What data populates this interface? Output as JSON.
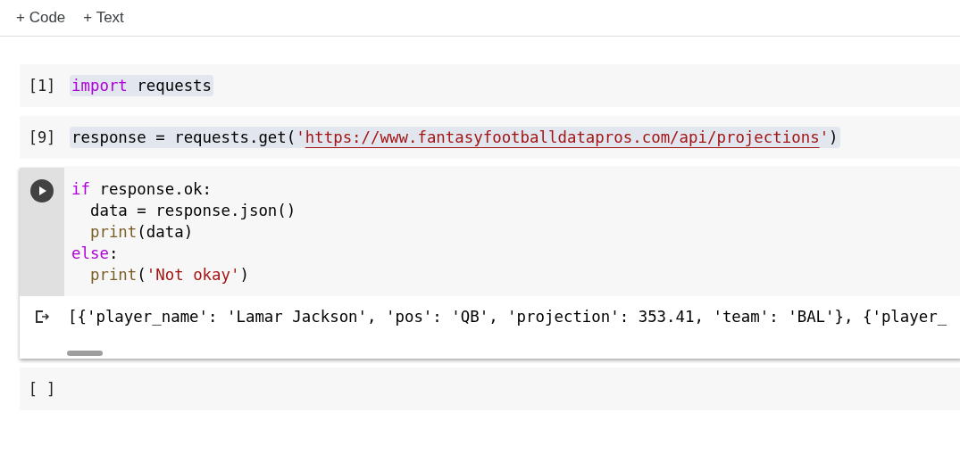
{
  "toolbar": [
    {
      "icon": "+",
      "label": "Code"
    },
    {
      "icon": "+",
      "label": "Text"
    }
  ],
  "cells": [
    {
      "kind": "code",
      "prompt": "[1]",
      "focused": false,
      "highlighted": true,
      "lines": [
        [
          {
            "kind": "keyword",
            "text": "import"
          },
          {
            "kind": "plain",
            "text": " requests"
          }
        ]
      ]
    },
    {
      "kind": "code",
      "prompt": "[9]",
      "focused": false,
      "highlighted": true,
      "lines": [
        [
          {
            "kind": "plain",
            "text": "response = requests.get("
          },
          {
            "kind": "string",
            "text": "'"
          },
          {
            "kind": "link",
            "text": "https://www.fantasyfootballdatapros.com/api/projections"
          },
          {
            "kind": "string",
            "text": "'"
          },
          {
            "kind": "plain",
            "text": ")"
          }
        ]
      ]
    },
    {
      "kind": "code",
      "focused": true,
      "lines": [
        [
          {
            "kind": "keyword",
            "text": "if"
          },
          {
            "kind": "plain",
            "text": " response.ok:"
          }
        ],
        [
          {
            "kind": "plain",
            "text": "  data = response.json()"
          }
        ],
        [
          {
            "kind": "builtin",
            "text": "  print"
          },
          {
            "kind": "plain",
            "text": "(data)"
          }
        ],
        [
          {
            "kind": "keyword",
            "text": "else"
          },
          {
            "kind": "plain",
            "text": ":"
          }
        ],
        [
          {
            "kind": "builtin",
            "text": "  print"
          },
          {
            "kind": "plain",
            "text": "("
          },
          {
            "kind": "string",
            "text": "'Not okay'"
          },
          {
            "kind": "plain",
            "text": ")"
          }
        ]
      ],
      "output": "[{'player_name': 'Lamar Jackson', 'pos': 'QB', 'projection': 353.41, 'team': 'BAL'}, {'player_"
    },
    {
      "kind": "code",
      "prompt": "[ ]",
      "focused": false
    }
  ]
}
